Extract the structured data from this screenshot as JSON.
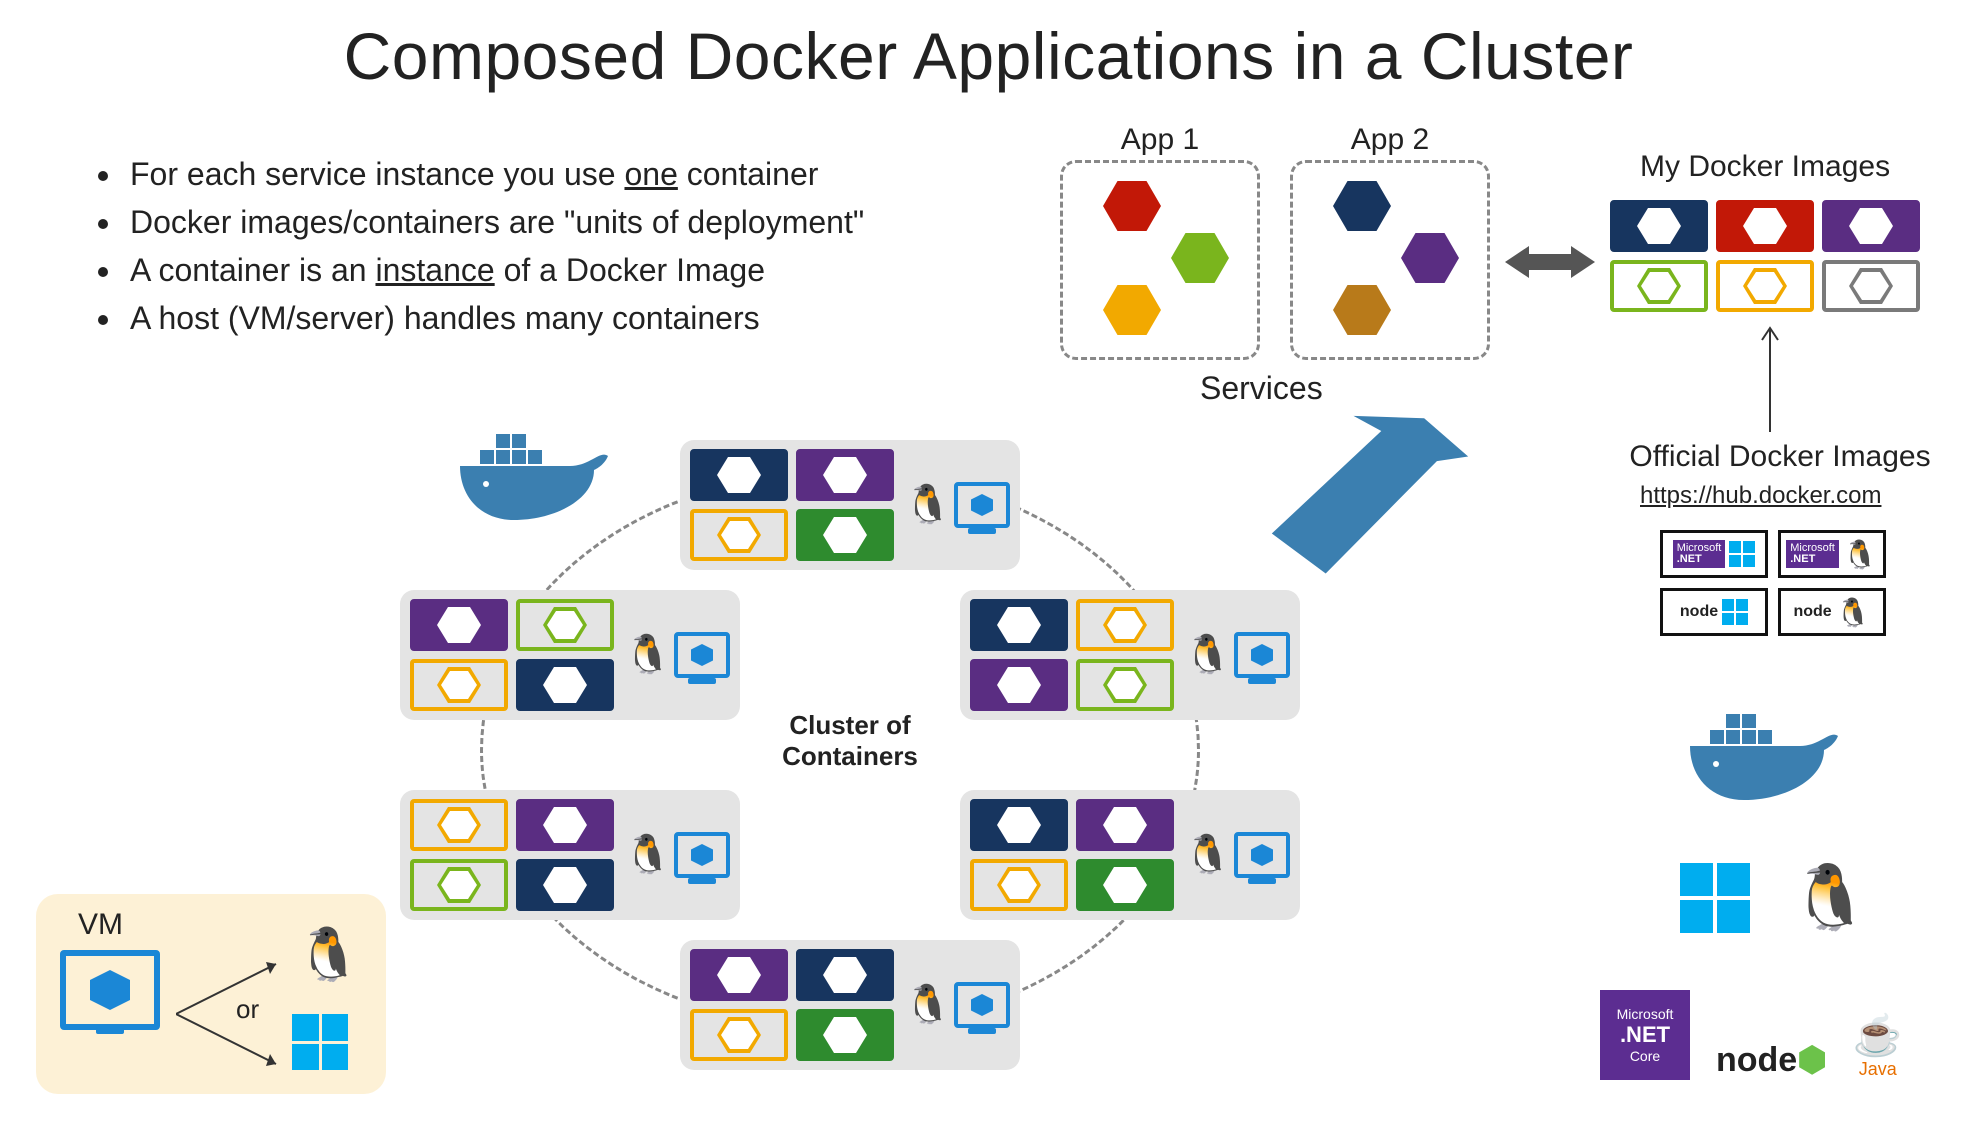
{
  "title": "Composed Docker Applications in a Cluster",
  "bullets": [
    {
      "pre": "For each service instance you use ",
      "u": "one",
      "post": " container"
    },
    {
      "pre": "Docker images/containers are \"units of deployment\"",
      "u": "",
      "post": ""
    },
    {
      "pre": "A container is an ",
      "u": "instance",
      "post": " of a Docker Image"
    },
    {
      "pre": "A host (VM/server) handles many containers",
      "u": "",
      "post": ""
    }
  ],
  "apps": {
    "app1_label": "App 1",
    "app2_label": "App 2",
    "services_label": "Services"
  },
  "my_images_label": "My Docker Images",
  "official_label": "Official Docker Images",
  "hub_link": "https://hub.docker.com",
  "cluster_label_l1": "Cluster of",
  "cluster_label_l2": "Containers",
  "vm": {
    "label": "VM",
    "or": "or"
  },
  "colors": {
    "navy": "#17355f",
    "purple": "#5a2d82",
    "yellow": "#f2a900",
    "green": "#7ab51d",
    "darkgreen": "#2e8b2e",
    "red": "#c21807",
    "brown": "#b87a1a",
    "gray": "#7a7a7a",
    "blue": "#3b7fb0"
  },
  "official_images": [
    {
      "tech": ".NET",
      "os": "windows"
    },
    {
      "tech": ".NET",
      "os": "linux"
    },
    {
      "tech": "node",
      "os": "windows"
    },
    {
      "tech": "node",
      "os": "linux"
    }
  ],
  "tech_logos": {
    "netcore_top": "Microsoft",
    "netcore_mid": ".NET",
    "netcore_bot": "Core",
    "node": "node",
    "java": "Java"
  },
  "cluster_nodes": [
    {
      "c": [
        "navy",
        "purple",
        "yellow",
        "darkgreen"
      ]
    },
    {
      "c": [
        "purple",
        "green",
        "yellow",
        "navy"
      ]
    },
    {
      "c": [
        "navy",
        "yellow",
        "purple",
        "green"
      ]
    },
    {
      "c": [
        "yellow",
        "purple",
        "green",
        "navy"
      ]
    },
    {
      "c": [
        "navy",
        "purple",
        "yellow",
        "darkgreen"
      ]
    },
    {
      "c": [
        "purple",
        "navy",
        "yellow",
        "darkgreen"
      ]
    }
  ]
}
